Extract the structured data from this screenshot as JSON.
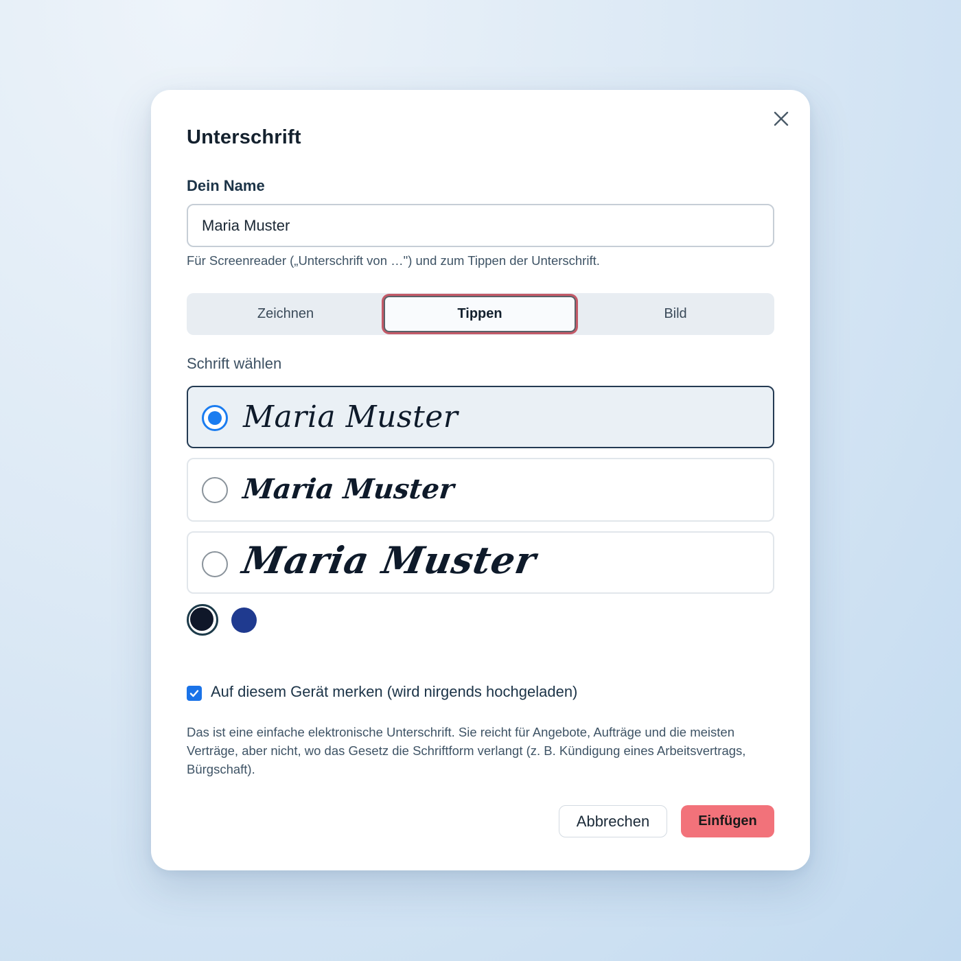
{
  "dialog": {
    "title": "Unterschrift",
    "close_icon": "close-icon"
  },
  "name_field": {
    "label": "Dein Name",
    "value": "Maria Muster",
    "hint": "Für Screenreader („Unterschrift von …\") und zum Tippen der Unterschrift."
  },
  "tabs": [
    {
      "label": "Zeichnen",
      "active": false
    },
    {
      "label": "Tippen",
      "active": true
    },
    {
      "label": "Bild",
      "active": false
    }
  ],
  "font_section": {
    "label": "Schrift wählen",
    "options": [
      {
        "text": "Maria Muster",
        "selected": true
      },
      {
        "text": "Maria Muster",
        "selected": false
      },
      {
        "text": "Maria Muster",
        "selected": false
      }
    ]
  },
  "colors": {
    "swatches": [
      "#0f1729",
      "#1f3a8f"
    ],
    "selected": "#0f1729",
    "accent": "#1a7cf0",
    "primary_button": "#f2727a"
  },
  "remember": {
    "checked": true,
    "label": "Auf diesem Gerät merken (wird nirgends hochgeladen)"
  },
  "disclaimer": "Das ist eine einfache elektronische Unterschrift. Sie reicht für Angebote, Aufträge und die meisten Verträge, aber nicht, wo das Gesetz die Schriftform verlangt (z. B. Kündigung eines Arbeitsvertrags, Bürgschaft).",
  "actions": {
    "cancel_label": "Abbrechen",
    "insert_label": "Einfügen"
  }
}
